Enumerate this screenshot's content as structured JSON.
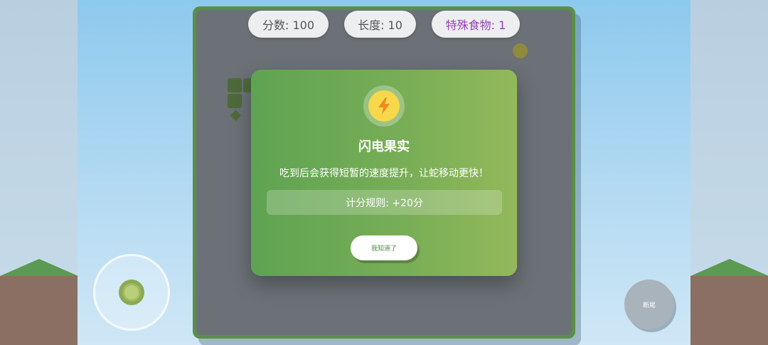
{
  "hud": {
    "score": "分数: 100",
    "length": "长度: 10",
    "special_food": "特殊食物: 1"
  },
  "modal": {
    "icon": "lightning-bolt-icon",
    "title": "闪电果实",
    "description": "吃到后会获得短暂的速度提升，让蛇移动更快！",
    "rule": "计分规则: +20分",
    "confirm_label": "我知道了"
  },
  "controls": {
    "cut_tail_label": "断尾"
  },
  "colors": {
    "board_border": "#5b8f48",
    "board_bg": "#6b7176",
    "modal_gradient_start": "#5ea352",
    "modal_gradient_end": "#92b95a",
    "special_food_text": "#9b3fb3",
    "icon_coin": "#f6d84a"
  }
}
